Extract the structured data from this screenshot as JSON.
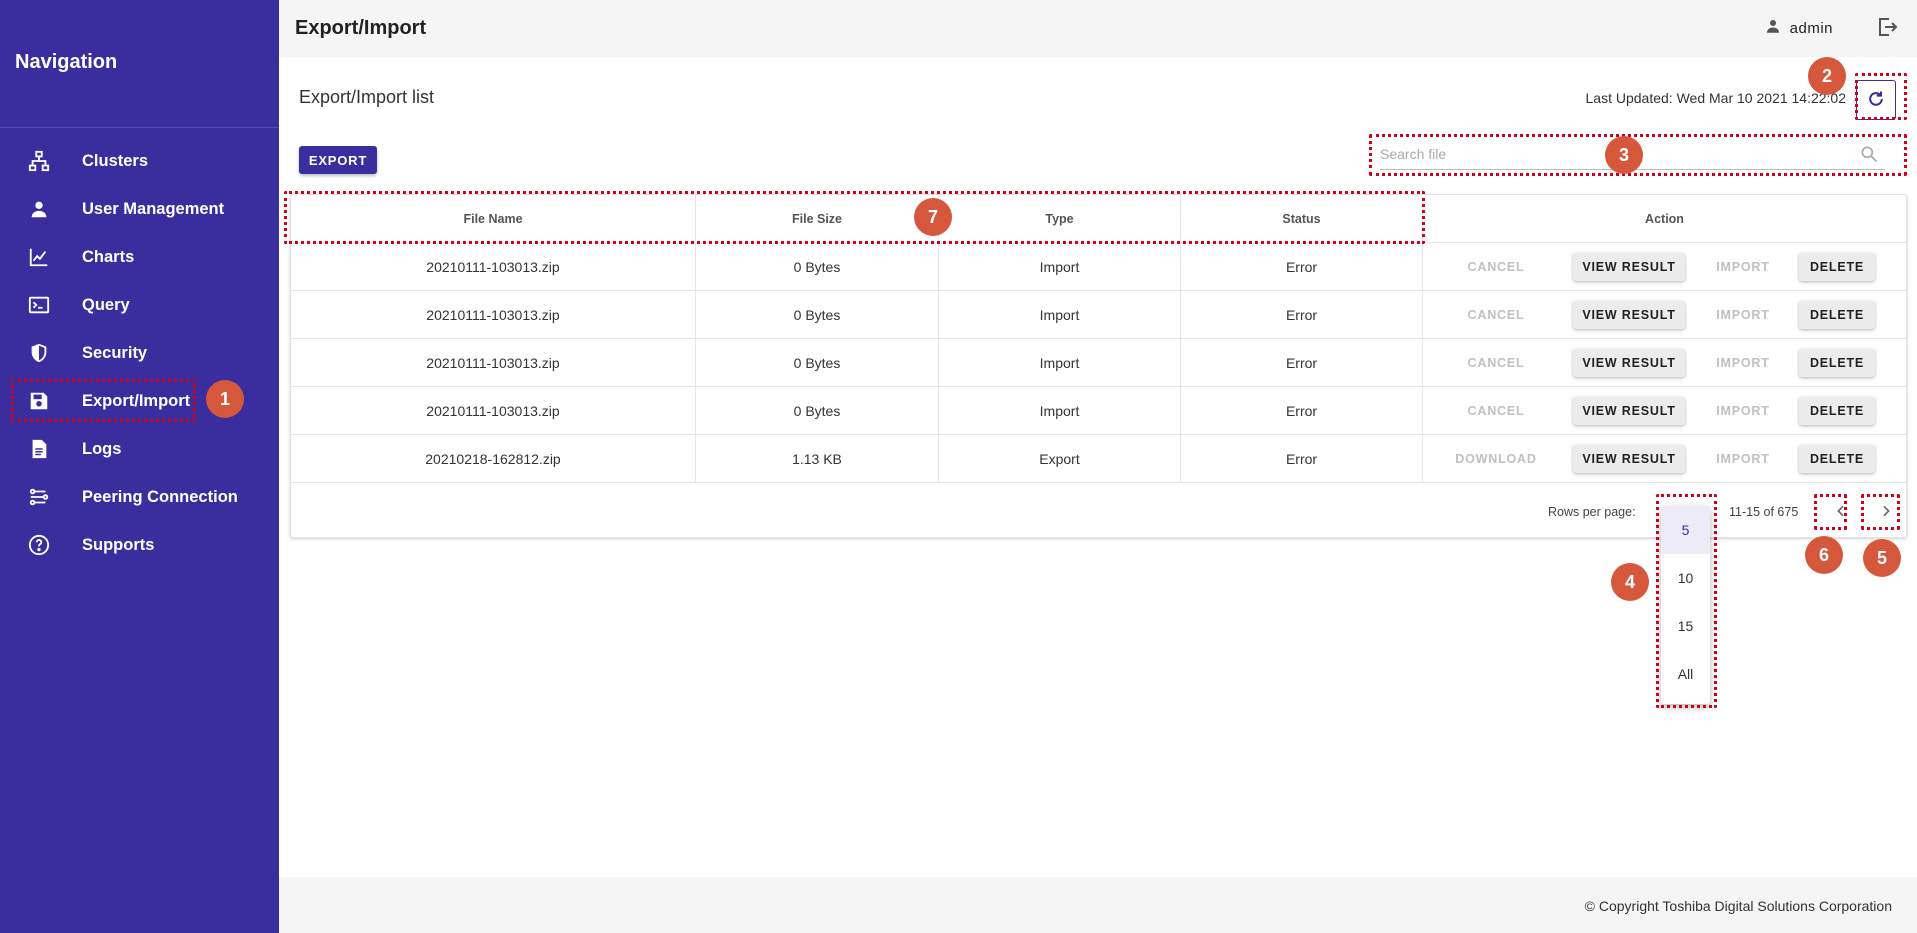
{
  "sidebar": {
    "title": "Navigation",
    "items": [
      {
        "label": "Clusters",
        "icon": "sitemap-icon"
      },
      {
        "label": "User Management",
        "icon": "person-icon"
      },
      {
        "label": "Charts",
        "icon": "line-chart-icon"
      },
      {
        "label": "Query",
        "icon": "terminal-icon"
      },
      {
        "label": "Security",
        "icon": "shield-icon"
      },
      {
        "label": "Export/Import",
        "icon": "save-icon"
      },
      {
        "label": "Logs",
        "icon": "document-icon"
      },
      {
        "label": "Peering Connection",
        "icon": "peering-icon"
      },
      {
        "label": "Supports",
        "icon": "help-icon"
      }
    ]
  },
  "header": {
    "title": "Export/Import",
    "user": "admin"
  },
  "main": {
    "list_title": "Export/Import list",
    "last_updated": "Last Updated: Wed Mar 10 2021 14:22:02",
    "export_label": "EXPORT",
    "search_placeholder": "Search file"
  },
  "table": {
    "columns": [
      "File Name",
      "File Size",
      "Type",
      "Status",
      "Action"
    ],
    "rows": [
      {
        "file": "20210111-103013.zip",
        "size": "0 Bytes",
        "type": "Import",
        "status": "Error",
        "actions": [
          "CANCEL",
          "VIEW RESULT",
          "IMPORT",
          "DELETE"
        ]
      },
      {
        "file": "20210111-103013.zip",
        "size": "0 Bytes",
        "type": "Import",
        "status": "Error",
        "actions": [
          "CANCEL",
          "VIEW RESULT",
          "IMPORT",
          "DELETE"
        ]
      },
      {
        "file": "20210111-103013.zip",
        "size": "0 Bytes",
        "type": "Import",
        "status": "Error",
        "actions": [
          "CANCEL",
          "VIEW RESULT",
          "IMPORT",
          "DELETE"
        ]
      },
      {
        "file": "20210111-103013.zip",
        "size": "0 Bytes",
        "type": "Import",
        "status": "Error",
        "actions": [
          "CANCEL",
          "VIEW RESULT",
          "IMPORT",
          "DELETE"
        ]
      },
      {
        "file": "20210218-162812.zip",
        "size": "1.13 KB",
        "type": "Export",
        "status": "Error",
        "actions": [
          "DOWNLOAD",
          "VIEW RESULT",
          "IMPORT",
          "DELETE"
        ]
      }
    ]
  },
  "pager": {
    "rows_per_page_label": "Rows per page:",
    "range": "11-15 of 675",
    "options": [
      "5",
      "10",
      "15",
      "All"
    ],
    "selected": "5"
  },
  "footer": {
    "copyright": "© Copyright Toshiba Digital Solutions Corporation"
  },
  "annotations": [
    "1",
    "2",
    "3",
    "4",
    "5",
    "6",
    "7"
  ],
  "colors": {
    "brand": "#3a2e9f",
    "annotation": "#d6583c",
    "highlight": "#d0021b"
  }
}
